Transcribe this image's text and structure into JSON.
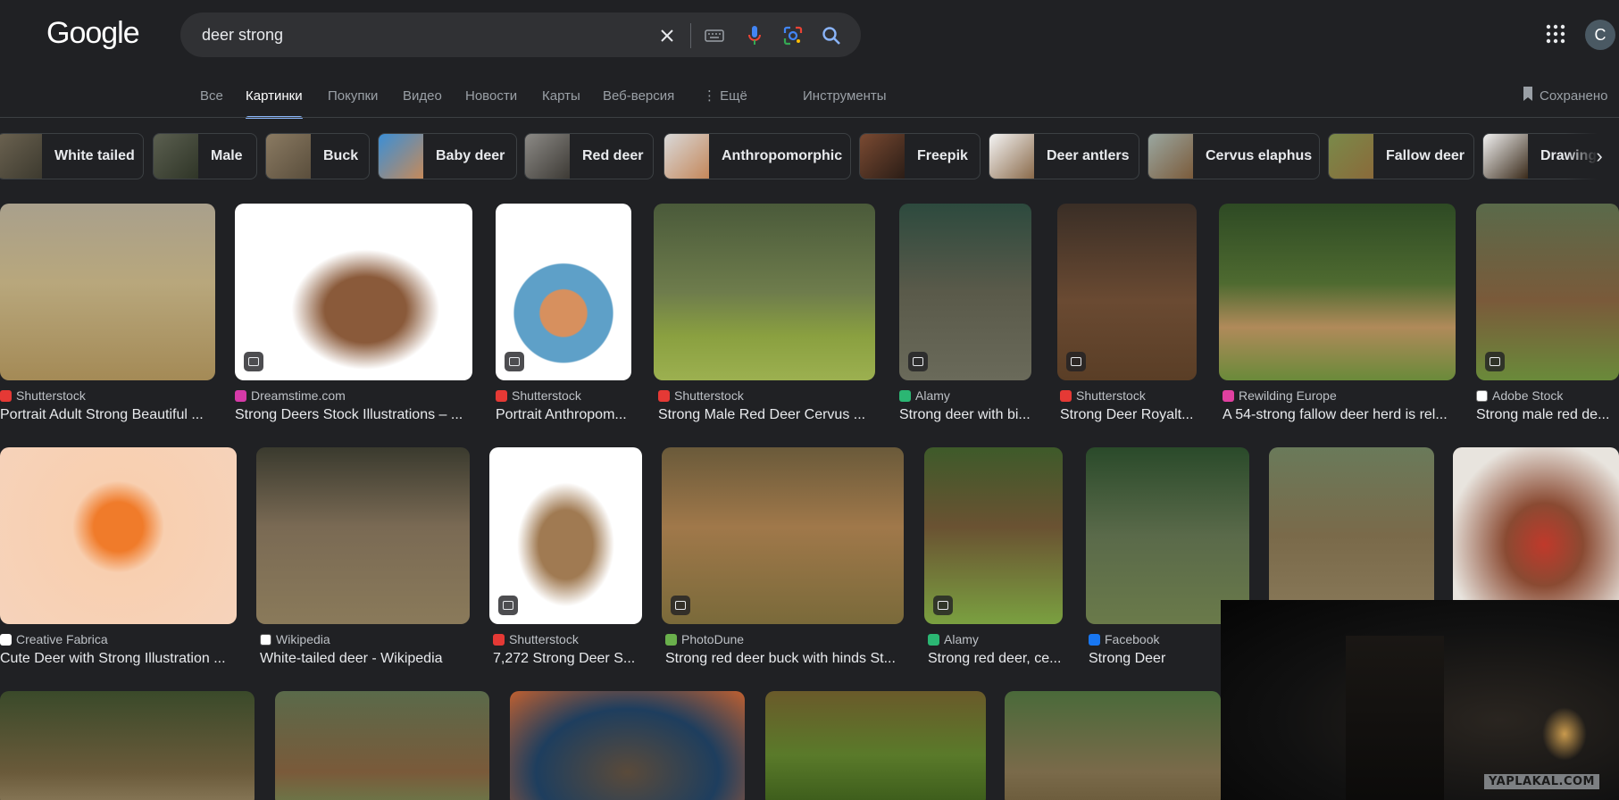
{
  "logo": "Google",
  "search": {
    "value": "deer strong"
  },
  "colors": {
    "background": "#202124",
    "accent": "#8ab4f8",
    "search_bg": "#303134"
  },
  "icons": [
    "clear-icon",
    "keyboard-icon",
    "mic-icon",
    "lens-icon",
    "search-icon",
    "apps-icon",
    "bookmark-icon",
    "chevron-right-icon",
    "image-badge-icon"
  ],
  "account": {
    "initial": "C"
  },
  "tabs": [
    "Все",
    "Картинки",
    "Покупки",
    "Видео",
    "Новости",
    "Карты",
    "Веб-версия",
    "⋮ Ещё",
    "Инструменты"
  ],
  "active_tab": "Картинки",
  "saved_label": "Сохранено",
  "chips": [
    "White tailed",
    "Male",
    "Buck",
    "Baby deer",
    "Red deer",
    "Anthropomorphic",
    "Freepik",
    "Deer antlers",
    "Cervus elaphus",
    "Fallow deer",
    "Drawing"
  ],
  "results": [
    {
      "source": "Shutterstock",
      "title": "Portrait Adult Strong Beautiful ..."
    },
    {
      "source": "Dreamstime.com",
      "title": "Strong Deers Stock Illustrations – ..."
    },
    {
      "source": "Shutterstock",
      "title": "Portrait Anthropom..."
    },
    {
      "source": "Shutterstock",
      "title": "Strong Male Red Deer Cervus ..."
    },
    {
      "source": "Alamy",
      "title": "Strong deer with bi..."
    },
    {
      "source": "Shutterstock",
      "title": "Strong Deer Royalt..."
    },
    {
      "source": "Rewilding Europe",
      "title": "A 54-strong fallow deer herd is rel..."
    },
    {
      "source": "Adobe Stock",
      "title": "Strong male red de..."
    },
    {
      "source": "Creative Fabrica",
      "title": "Cute Deer with Strong Illustration ..."
    },
    {
      "source": "Wikipedia",
      "title": "White-tailed deer - Wikipedia"
    },
    {
      "source": "Shutterstock",
      "title": "7,272 Strong Deer S..."
    },
    {
      "source": "PhotoDune",
      "title": "Strong red deer buck with hinds St..."
    },
    {
      "source": "Alamy",
      "title": "Strong red deer, ce..."
    },
    {
      "source": "Facebook",
      "title": "Strong Deer"
    }
  ],
  "video_watermark": "YAPLAKAL.COM"
}
